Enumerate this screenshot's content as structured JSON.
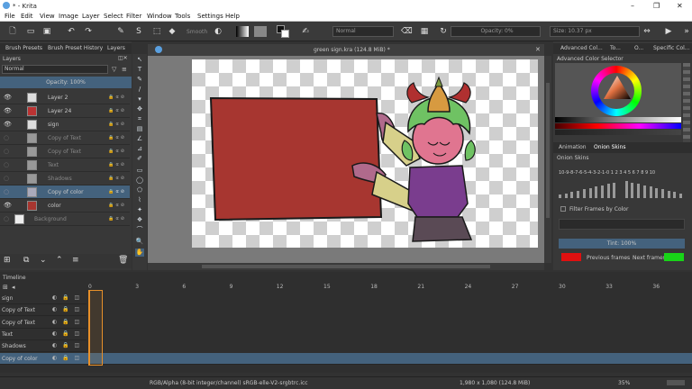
{
  "window": {
    "title": "* - Krita"
  },
  "menu": [
    "File",
    "Edit",
    "View",
    "Image",
    "Layer",
    "Select",
    "Filter",
    "Window",
    "Tools",
    "Settings",
    "Help"
  ],
  "toolbar": {
    "smooth_label": "Smooth",
    "blend_mode": "Normal",
    "opacity_label": "Opacity: 0%",
    "size_label": "Size: 10.37 px"
  },
  "left_tabs": [
    "Brush Presets",
    "Brush Preset History",
    "Layers"
  ],
  "layers_panel": {
    "title": "Layers",
    "blend_mode": "Normal",
    "opacity_label": "Opacity: 100%",
    "layers": [
      {
        "name": "Layer 2",
        "visible": true,
        "selected": false
      },
      {
        "name": "Layer 24",
        "visible": true,
        "selected": false
      },
      {
        "name": "sign",
        "visible": true,
        "selected": false
      },
      {
        "name": "Copy of Text",
        "visible": false,
        "selected": false
      },
      {
        "name": "Copy of Text",
        "visible": false,
        "selected": false
      },
      {
        "name": "Text",
        "visible": false,
        "selected": false
      },
      {
        "name": "Shadows",
        "visible": false,
        "selected": false
      },
      {
        "name": "Copy of color",
        "visible": false,
        "selected": true
      },
      {
        "name": "color",
        "visible": true,
        "selected": false
      },
      {
        "name": "Background",
        "visible": false,
        "selected": false
      }
    ]
  },
  "document": {
    "title": "green sign.kra (124.8 MiB) *"
  },
  "right_tabs": [
    "Advanced Col...",
    "To...",
    "O...",
    "Specific Col..."
  ],
  "color_selector": {
    "title": "Advanced Color Selector"
  },
  "onion_tabs": [
    "Animation",
    "Onion Skins"
  ],
  "onion": {
    "title": "Onion Skins",
    "negative_frames": [
      "10",
      "9",
      "8",
      "7",
      "6",
      "5",
      "4",
      "3",
      "2",
      "1"
    ],
    "current_frame": "0",
    "positive_frames": [
      "1",
      "2",
      "3",
      "4",
      "5",
      "6",
      "7",
      "8",
      "9",
      "10"
    ],
    "filter_label": "Filter Frames by Color",
    "tint_label": "Tint: 100%",
    "previous_label": "Previous frames",
    "next_label": "Next frames",
    "previous_color": "#e01010",
    "next_color": "#18d418"
  },
  "timeline": {
    "title": "Timeline",
    "frames": [
      "0",
      "3",
      "6",
      "9",
      "12",
      "15",
      "18",
      "21",
      "24",
      "27",
      "30",
      "33",
      "36"
    ],
    "rows": [
      "sign",
      "Copy of Text",
      "Copy of Text",
      "Text",
      "Shadows",
      "Copy of color"
    ]
  },
  "status": {
    "colorspace": "RGB/Alpha (8-bit integer/channel)  sRGB-elle-V2-srgbtrc.icc",
    "dimensions": "1,980 x 1,080 (124.8 MiB)",
    "zoom": "35%"
  },
  "colors": {
    "accent": "#44627d",
    "sign_red": "#a73630",
    "playhead": "#e8902a"
  }
}
